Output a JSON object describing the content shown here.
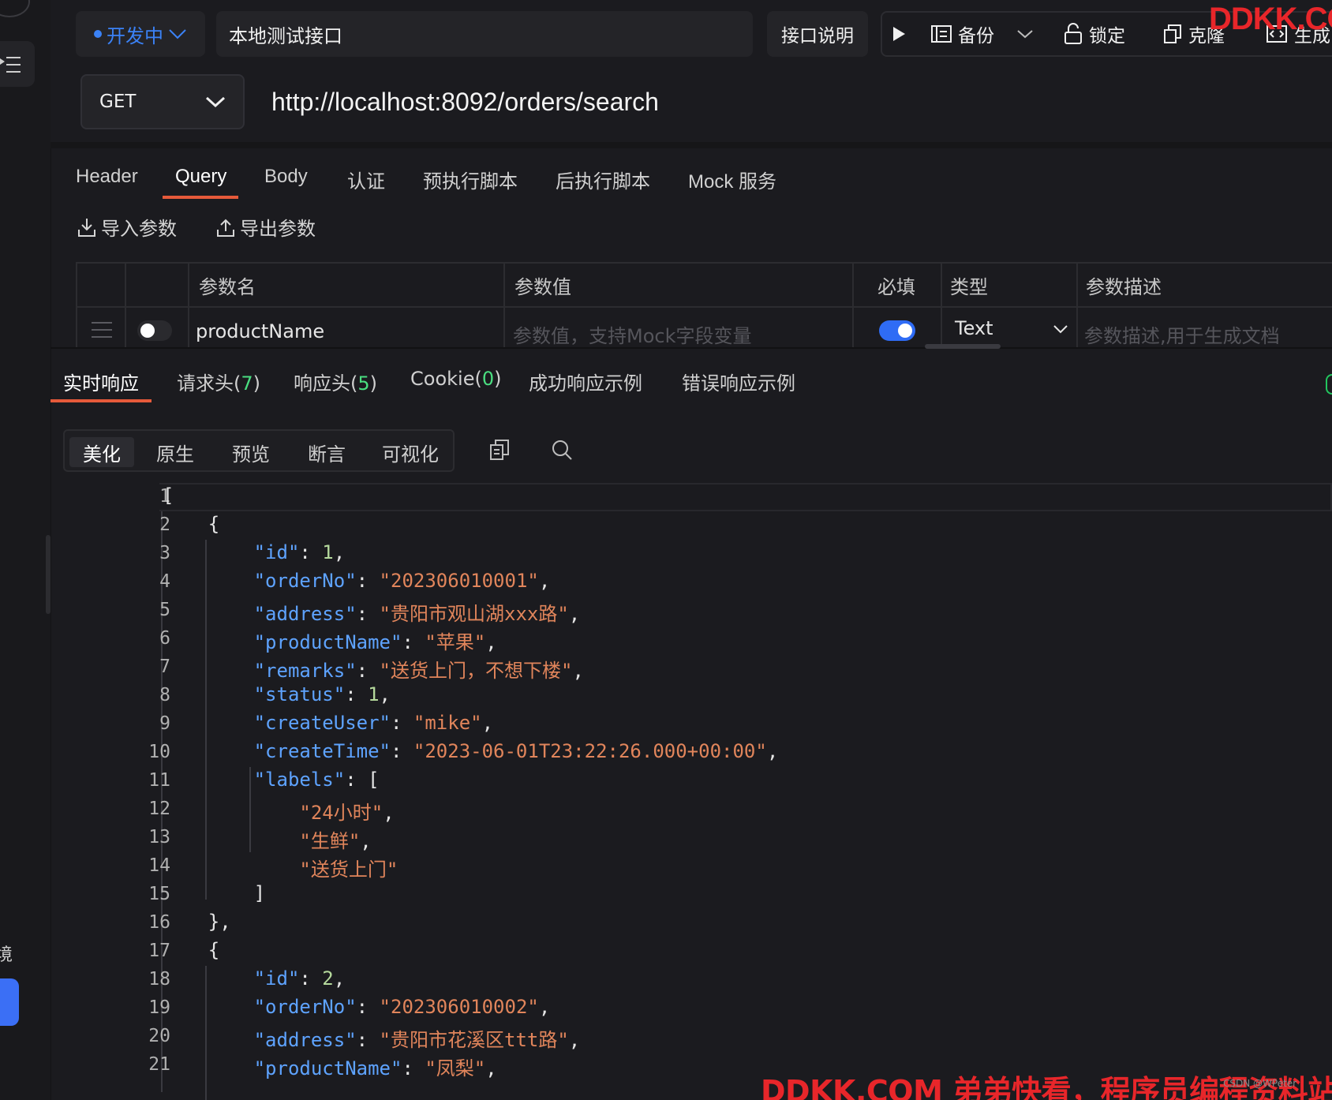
{
  "colors": {
    "background": "#1b1b1f",
    "accent_blue": "#3b82f6",
    "accent_orange": "#e65a3a",
    "count_green": "#4ade80",
    "key_color": "#5ea3ff",
    "string_color": "#e1855b",
    "number_color": "#b5d99c",
    "watermark_red": "#e8262a"
  },
  "toolbar": {
    "status_label": "开发中",
    "api_name": "本地测试接口",
    "doc_label": "接口说明",
    "backup_label": "备份",
    "lock_label": "锁定",
    "clone_label": "克隆",
    "generate_label": "生成",
    "watermark": "DDKK.COM"
  },
  "request": {
    "method": "GET",
    "url": "http://localhost:8092/orders/search"
  },
  "request_tabs": [
    "Header",
    "Query",
    "Body",
    "认证",
    "预执行脚本",
    "后执行脚本",
    "Mock 服务"
  ],
  "param_actions": {
    "import_label": "导入参数",
    "export_label": "导出参数"
  },
  "params_table": {
    "headers": {
      "name": "参数名",
      "value": "参数值",
      "required": "必填",
      "type": "类型",
      "description": "参数描述"
    },
    "row": {
      "name": "productName",
      "value_placeholder": "参数值，支持Mock字段变量",
      "type": "Text",
      "description_placeholder": "参数描述,用于生成文档",
      "enabled": false,
      "required": true
    }
  },
  "response_tabs": {
    "realtime": "实时响应",
    "req_headers": "请求头(",
    "req_headers_count": "7",
    "resp_headers": "响应头(",
    "resp_headers_count": "5",
    "cookie": "Cookie(",
    "cookie_count": "0",
    "close_paren": ")",
    "success_example": "成功响应示例",
    "error_example": "错误响应示例"
  },
  "view_modes": {
    "pretty": "美化",
    "raw": "原生",
    "preview": "预览",
    "assert": "断言",
    "visualize": "可视化"
  },
  "code": {
    "line_numbers": [
      "1",
      "2",
      "3",
      "4",
      "5",
      "6",
      "7",
      "8",
      "9",
      "10",
      "11",
      "12",
      "13",
      "14",
      "15",
      "16",
      "17",
      "18",
      "19",
      "20",
      "21"
    ],
    "lines": [
      [
        [
          "p",
          "["
        ]
      ],
      [
        [
          "p",
          "    {"
        ]
      ],
      [
        [
          "p",
          "        "
        ],
        [
          "k",
          "\"id\""
        ],
        [
          "p",
          ": "
        ],
        [
          "n",
          "1"
        ],
        [
          "p",
          ","
        ]
      ],
      [
        [
          "p",
          "        "
        ],
        [
          "k",
          "\"orderNo\""
        ],
        [
          "p",
          ": "
        ],
        [
          "s",
          "\"202306010001\""
        ],
        [
          "p",
          ","
        ]
      ],
      [
        [
          "p",
          "        "
        ],
        [
          "k",
          "\"address\""
        ],
        [
          "p",
          ": "
        ],
        [
          "s",
          "\"贵阳市观山湖xxx路\""
        ],
        [
          "p",
          ","
        ]
      ],
      [
        [
          "p",
          "        "
        ],
        [
          "k",
          "\"productName\""
        ],
        [
          "p",
          ": "
        ],
        [
          "s",
          "\"苹果\""
        ],
        [
          "p",
          ","
        ]
      ],
      [
        [
          "p",
          "        "
        ],
        [
          "k",
          "\"remarks\""
        ],
        [
          "p",
          ": "
        ],
        [
          "s",
          "\"送货上门，不想下楼\""
        ],
        [
          "p",
          ","
        ]
      ],
      [
        [
          "p",
          "        "
        ],
        [
          "k",
          "\"status\""
        ],
        [
          "p",
          ": "
        ],
        [
          "n",
          "1"
        ],
        [
          "p",
          ","
        ]
      ],
      [
        [
          "p",
          "        "
        ],
        [
          "k",
          "\"createUser\""
        ],
        [
          "p",
          ": "
        ],
        [
          "s",
          "\"mike\""
        ],
        [
          "p",
          ","
        ]
      ],
      [
        [
          "p",
          "        "
        ],
        [
          "k",
          "\"createTime\""
        ],
        [
          "p",
          ": "
        ],
        [
          "s",
          "\"2023-06-01T23:22:26.000+00:00\""
        ],
        [
          "p",
          ","
        ]
      ],
      [
        [
          "p",
          "        "
        ],
        [
          "k",
          "\"labels\""
        ],
        [
          "p",
          ": ["
        ]
      ],
      [
        [
          "p",
          "            "
        ],
        [
          "s",
          "\"24小时\""
        ],
        [
          "p",
          ","
        ]
      ],
      [
        [
          "p",
          "            "
        ],
        [
          "s",
          "\"生鲜\""
        ],
        [
          "p",
          ","
        ]
      ],
      [
        [
          "p",
          "            "
        ],
        [
          "s",
          "\"送货上门\""
        ]
      ],
      [
        [
          "p",
          "        ]"
        ]
      ],
      [
        [
          "p",
          "    },"
        ]
      ],
      [
        [
          "p",
          "    {"
        ]
      ],
      [
        [
          "p",
          "        "
        ],
        [
          "k",
          "\"id\""
        ],
        [
          "p",
          ": "
        ],
        [
          "n",
          "2"
        ],
        [
          "p",
          ","
        ]
      ],
      [
        [
          "p",
          "        "
        ],
        [
          "k",
          "\"orderNo\""
        ],
        [
          "p",
          ": "
        ],
        [
          "s",
          "\"202306010002\""
        ],
        [
          "p",
          ","
        ]
      ],
      [
        [
          "p",
          "        "
        ],
        [
          "k",
          "\"address\""
        ],
        [
          "p",
          ": "
        ],
        [
          "s",
          "\"贵阳市花溪区ttt路\""
        ],
        [
          "p",
          ","
        ]
      ],
      [
        [
          "p",
          "        "
        ],
        [
          "k",
          "\"productName\""
        ],
        [
          "p",
          ": "
        ],
        [
          "s",
          "\"凤梨\""
        ],
        [
          "p",
          ","
        ]
      ]
    ]
  },
  "footer": {
    "watermark": "DDKK.COM 弟弟快看，程序员编程资料站",
    "small_mark": "CSDN @WPeter"
  },
  "icons": {
    "menu": "sidebar-menu-icon",
    "status_dropdown": "chevron-down-icon",
    "run": "play-icon",
    "backup": "backup-icon",
    "lock": "unlock-icon",
    "clone": "clone-icon",
    "generate": "code-icon",
    "method_dropdown": "chevron-down-icon",
    "import": "download-icon",
    "export": "upload-icon",
    "drag": "drag-handle-icon",
    "type_dropdown": "chevron-down-icon",
    "copy": "copy-icon",
    "search": "search-icon"
  }
}
